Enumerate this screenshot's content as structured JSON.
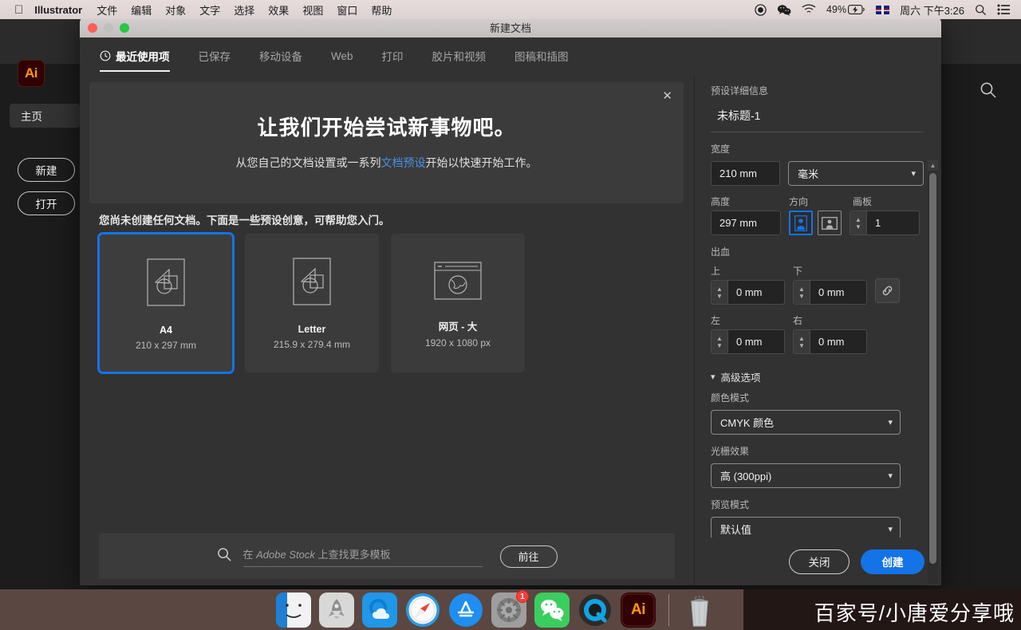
{
  "menubar": {
    "apple_icon": "apple-icon",
    "app_name": "Illustrator",
    "items": [
      "文件",
      "编辑",
      "对象",
      "文字",
      "选择",
      "效果",
      "视图",
      "窗口",
      "帮助"
    ],
    "status": {
      "record_icon": "screen-record-icon",
      "wechat_icon": "wechat-icon",
      "wifi_icon": "wifi-icon",
      "battery_percent": "49%",
      "battery_icon": "battery-charging-icon",
      "input_flag": "uk-flag-icon",
      "clock": "周六 下午3:26",
      "search_icon": "spotlight-search-icon",
      "control_center_icon": "control-center-icon"
    }
  },
  "ai_home": {
    "logo_text": "Ai",
    "search_icon": "search-icon",
    "home_label": "主页",
    "new_label": "新建",
    "open_label": "打开"
  },
  "dialog": {
    "title": "新建文档",
    "tabs": [
      {
        "label": "最近使用项",
        "icon": "clock-icon",
        "active": true
      },
      {
        "label": "已保存",
        "active": false
      },
      {
        "label": "移动设备",
        "active": false
      },
      {
        "label": "Web",
        "active": false
      },
      {
        "label": "打印",
        "active": false
      },
      {
        "label": "胶片和视频",
        "active": false
      },
      {
        "label": "图稿和插图",
        "active": false
      }
    ],
    "banner": {
      "close_icon": "close-icon",
      "heading": "让我们开始尝试新事物吧。",
      "sub_before": "从您自己的文档设置或一系列",
      "sub_link": "文档预设",
      "sub_after": "开始以快速开始工作。"
    },
    "hint": "您尚未创建任何文档。下面是一些预设创意，可帮助您入门。",
    "presets": [
      {
        "name": "A4",
        "size": "210 x 297 mm",
        "icon": "page-shapes-icon",
        "selected": true
      },
      {
        "name": "Letter",
        "size": "215.9 x 279.4 mm",
        "icon": "page-shapes-icon",
        "selected": false
      },
      {
        "name": "网页 - 大",
        "size": "1920 x 1080 px",
        "icon": "web-globe-icon",
        "selected": false
      }
    ],
    "stock": {
      "search_icon": "search-icon",
      "placeholder_cn_1": "在 ",
      "placeholder_brand": "Adobe Stock",
      "placeholder_cn_2": " 上查找更多模板",
      "go_label": "前往"
    }
  },
  "preset_details": {
    "section_label": "预设详细信息",
    "doc_name": "未标题-1",
    "width_label": "宽度",
    "width_value": "210 mm",
    "unit_value": "毫米",
    "unit_chevron_icon": "chevron-down-icon",
    "height_label": "高度",
    "height_value": "297 mm",
    "orientation_label": "方向",
    "orientation_portrait_icon": "portrait-orientation-icon",
    "orientation_landscape_icon": "landscape-orientation-icon",
    "artboards_label": "画板",
    "artboards_value": "1",
    "bleed_label": "出血",
    "bleed_top_label": "上",
    "bleed_top_value": "0 mm",
    "bleed_bottom_label": "下",
    "bleed_bottom_value": "0 mm",
    "bleed_left_label": "左",
    "bleed_left_value": "0 mm",
    "bleed_right_label": "右",
    "bleed_right_value": "0 mm",
    "bleed_link_icon": "link-icon",
    "advanced_label": "高级选项",
    "advanced_chevron_icon": "chevron-down-icon",
    "color_mode_label": "颜色模式",
    "color_mode_value": "CMYK 颜色",
    "raster_label": "光栅效果",
    "raster_value": "高 (300ppi)",
    "preview_label": "预览模式",
    "preview_value": "默认值",
    "close_label": "关闭",
    "create_label": "创建",
    "accent_color": "#1473e6"
  },
  "dock": {
    "items": [
      {
        "name": "finder-icon"
      },
      {
        "name": "launchpad-icon"
      },
      {
        "name": "cloud-app-icon"
      },
      {
        "name": "safari-icon"
      },
      {
        "name": "app-store-icon"
      },
      {
        "name": "system-preferences-icon",
        "badge": "1"
      },
      {
        "name": "wechat-icon"
      },
      {
        "name": "quicktime-icon"
      },
      {
        "name": "illustrator-icon",
        "label": "Ai"
      },
      {
        "name": "trash-icon"
      }
    ]
  },
  "watermark": {
    "text": "百家号/小唐爱分享哦"
  }
}
